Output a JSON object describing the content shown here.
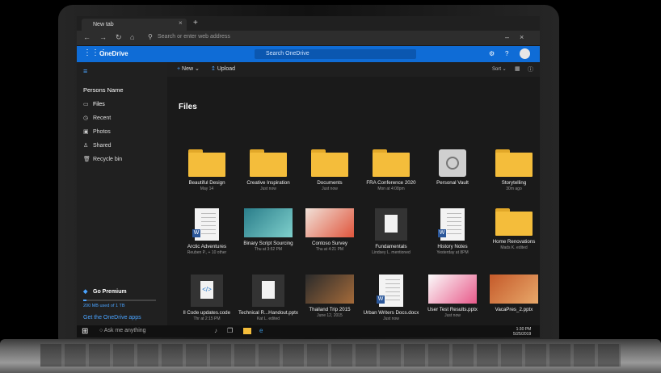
{
  "browser": {
    "tab_title": "New tab",
    "address_placeholder": "Search or enter web address"
  },
  "app": {
    "name": "OneDrive",
    "search_placeholder": "Search OneDrive"
  },
  "toolbar": {
    "new_label": "New",
    "upload_label": "Upload",
    "sort_label": "Sort"
  },
  "sidebar": {
    "user": "Persons Name",
    "items": [
      {
        "label": "Files",
        "icon": "folder-icon"
      },
      {
        "label": "Recent",
        "icon": "clock-icon"
      },
      {
        "label": "Photos",
        "icon": "image-icon"
      },
      {
        "label": "Shared",
        "icon": "people-icon"
      },
      {
        "label": "Recycle bin",
        "icon": "trash-icon"
      }
    ],
    "premium_label": "Go Premium",
    "storage_text": "200 MB used of 1 TB",
    "apps_link": "Get the OneDrive apps"
  },
  "main": {
    "title": "Files",
    "tiles": [
      {
        "name": "Beautiful Design",
        "sub": "May 14",
        "kind": "folder"
      },
      {
        "name": "Creative Inspiration",
        "sub": "Just now",
        "kind": "folder"
      },
      {
        "name": "Documents",
        "sub": "Just now",
        "kind": "folder"
      },
      {
        "name": "FRA Conference 2020",
        "sub": "Mon at 4:08pm",
        "kind": "folder"
      },
      {
        "name": "Personal Vault",
        "sub": "",
        "kind": "vault"
      },
      {
        "name": "Storytelling",
        "sub": "30m ago",
        "kind": "folder"
      },
      {
        "name": "Arctic Adventures",
        "sub": "Reuben P., + 10 other",
        "kind": "doc"
      },
      {
        "name": "Binary Script Sourcing",
        "sub": "Thu at 3:52 PM",
        "kind": "pic"
      },
      {
        "name": "Contoso Survey",
        "sub": "Thu at 4:21 PM",
        "kind": "pic"
      },
      {
        "name": "Fundamentals",
        "sub": "Lindsey L. mentioned",
        "kind": "file"
      },
      {
        "name": "History Notes",
        "sub": "Yesterday at 8PM",
        "kind": "doc"
      },
      {
        "name": "Home Renovations",
        "sub": "Mads K. edited",
        "kind": "folder"
      },
      {
        "name": "ll Code updates.code",
        "sub": "Thr at 2:15 PM",
        "kind": "code"
      },
      {
        "name": "Technical R...Handout.pptx",
        "sub": "Kat L. edited",
        "kind": "file"
      },
      {
        "name": "Thailand Trip 2015",
        "sub": "June 12, 2015",
        "kind": "pic"
      },
      {
        "name": "Urban Writers Docs.docx",
        "sub": "Just now",
        "kind": "doc"
      },
      {
        "name": "User Test Results.pptx",
        "sub": "Just now",
        "kind": "pic"
      },
      {
        "name": "VacaPres_2.pptx",
        "sub": "",
        "kind": "pic"
      }
    ]
  },
  "taskbar": {
    "cortana_placeholder": "Ask me anything",
    "time": "1:30 PM",
    "date": "5/25/2019"
  },
  "colors": {
    "accent": "#0f6cd6",
    "folder": "#f4bd3b"
  }
}
